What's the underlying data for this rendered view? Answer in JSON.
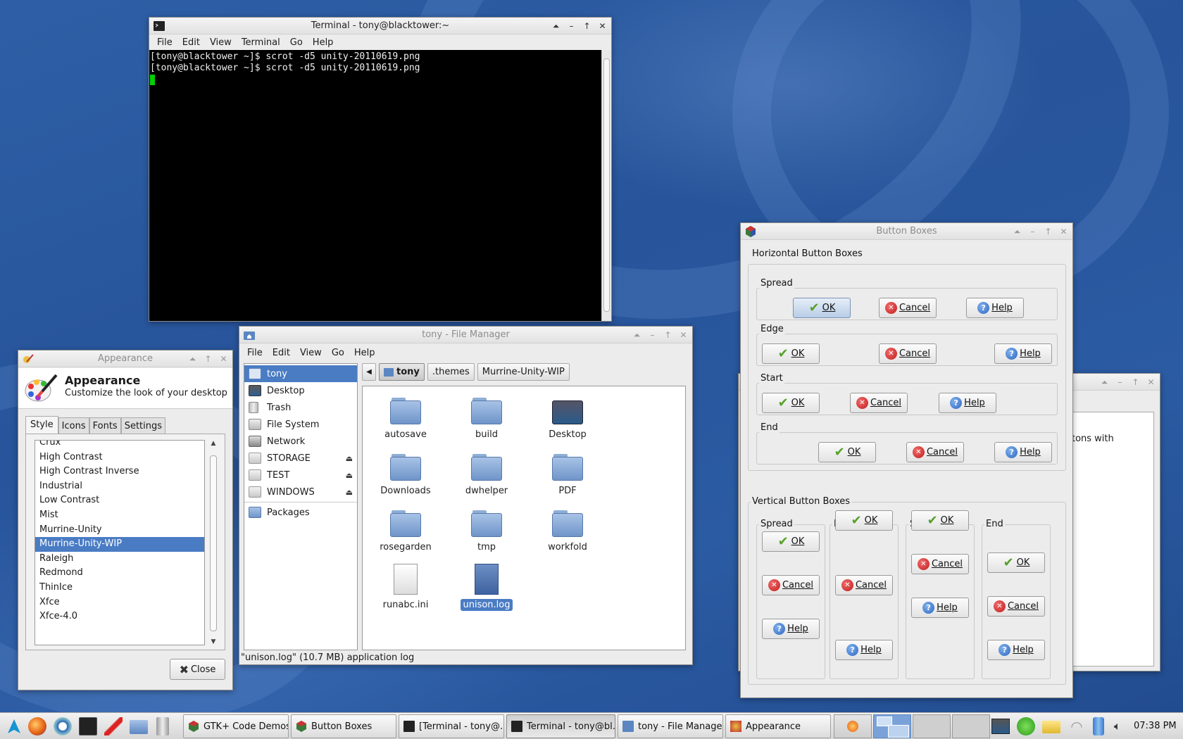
{
  "terminal": {
    "title": "Terminal - tony@blacktower:~",
    "menu": [
      "File",
      "Edit",
      "View",
      "Terminal",
      "Go",
      "Help"
    ],
    "lines": [
      "[tony@blacktower ~]$ scrot -d5 unity-20110619.png",
      "[tony@blacktower ~]$ scrot -d5 unity-20110619.png"
    ],
    "cursor_color": "#00d000"
  },
  "appearance": {
    "title": "Appearance",
    "header_title": "Appearance",
    "header_subtitle": "Customize the look of your desktop",
    "tabs": [
      "Style",
      "Icons",
      "Fonts",
      "Settings"
    ],
    "themes": [
      "Crux",
      "High Contrast",
      "High Contrast Inverse",
      "Industrial",
      "Low Contrast",
      "Mist",
      "Murrine-Unity",
      "Murrine-Unity-WIP",
      "Raleigh",
      "Redmond",
      "ThinIce",
      "Xfce",
      "Xfce-4.0"
    ],
    "selected_theme": "Murrine-Unity-WIP",
    "close_label": "Close"
  },
  "filemanager": {
    "title": "tony - File Manager",
    "menu": [
      "File",
      "Edit",
      "View",
      "Go",
      "Help"
    ],
    "places": [
      {
        "label": "tony",
        "icon": "home-icon",
        "eject": false
      },
      {
        "label": "Desktop",
        "icon": "desktop-icon",
        "eject": false
      },
      {
        "label": "Trash",
        "icon": "trash-icon",
        "eject": false
      },
      {
        "label": "File System",
        "icon": "harddisk-icon",
        "eject": false
      },
      {
        "label": "Network",
        "icon": "network-icon",
        "eject": false
      },
      {
        "label": "STORAGE",
        "icon": "drive-icon",
        "eject": true
      },
      {
        "label": "TEST",
        "icon": "drive-icon",
        "eject": true
      },
      {
        "label": "WINDOWS",
        "icon": "drive-icon",
        "eject": true
      }
    ],
    "bookmark": "Packages",
    "path": [
      "tony",
      ".themes",
      "Murrine-Unity-WIP"
    ],
    "items": [
      "autosave",
      "build",
      "Desktop",
      "Downloads",
      "dwhelper",
      "PDF",
      "rosegarden",
      "tmp",
      "workfold",
      "runabc.ini",
      "unison.log"
    ],
    "selected_item": "unison.log",
    "status": "\"unison.log\" (10.7 MB) application log"
  },
  "buttonboxes": {
    "title": "Button Boxes",
    "horizontal_label": "Horizontal Button Boxes",
    "vertical_label": "Vertical Button Boxes",
    "layouts": [
      "Spread",
      "Edge",
      "Start",
      "End"
    ],
    "ok": "OK",
    "cancel": "Cancel",
    "help": "Help"
  },
  "background_window": {
    "snippet": "ge buttons with"
  },
  "taskbar": {
    "tasks": [
      "GTK+ Code Demos",
      "Button Boxes",
      "[Terminal - tony@...",
      "Terminal - tony@bl...",
      "tony - File Manager",
      "Appearance"
    ],
    "clock": "07:38 PM"
  },
  "colors": {
    "desktop": "#2b5ba3",
    "selection": "#4a7cc4",
    "terminal_bg": "#000000"
  }
}
